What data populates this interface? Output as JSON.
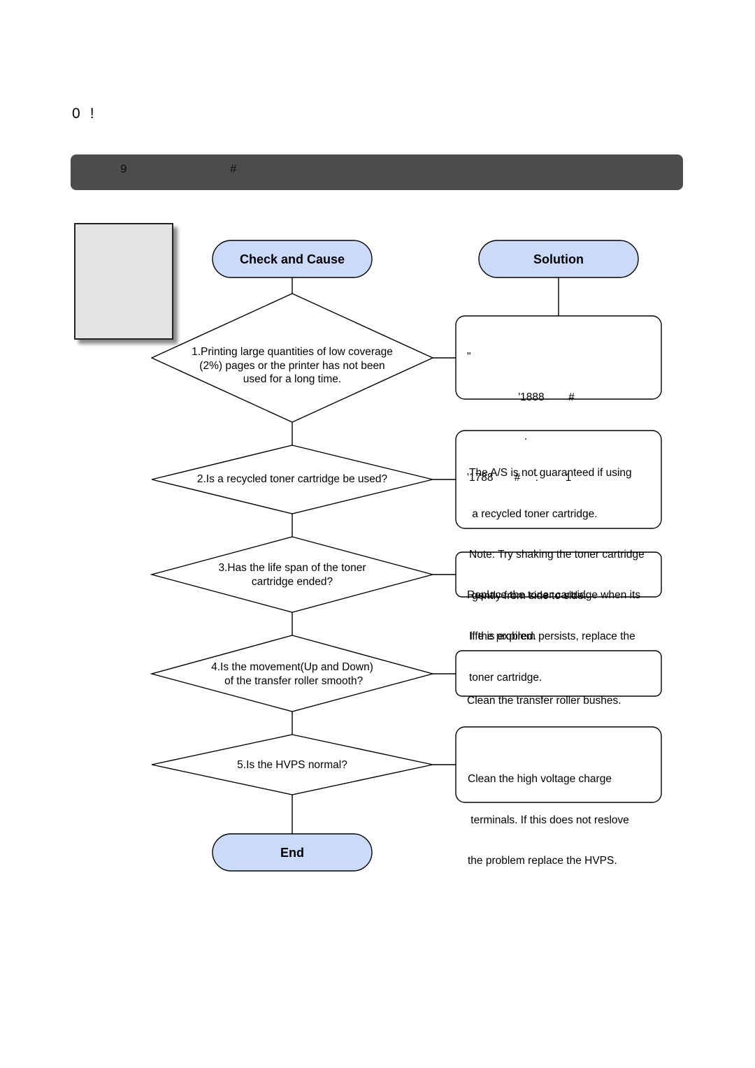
{
  "page": {
    "heading": [
      "0",
      "!"
    ],
    "title_bar": {
      "left": "9",
      "right": "#"
    }
  },
  "flowchart": {
    "headers": {
      "cause": "Check and Cause",
      "solution": "Solution"
    },
    "end_label": "End",
    "steps": [
      {
        "question": [
          "1.Printing large quantities of low coverage",
          "(2%) pages or the printer has not been",
          "used for a long time."
        ],
        "solution": [
          "\"",
          "                 '1888        #",
          "                   .",
          "'1788       #     :         1"
        ]
      },
      {
        "question": [
          "2.Is a recycled toner cartridge be used?"
        ],
        "solution": [
          "The A/S is not guaranteed if using",
          " a recycled toner cartridge.",
          "Note: Try shaking the toner cartridge",
          " gently from side to side.",
          "If the problem persists, replace the",
          "toner cartridge."
        ]
      },
      {
        "question": [
          "3.Has the life span of the toner",
          "cartridge ended?"
        ],
        "solution": [
          "Replace the toner cartridge when its",
          " life is expired."
        ]
      },
      {
        "question": [
          "4.Is the movement(Up and Down)",
          " of the transfer roller smooth?"
        ],
        "solution": [
          "Clean the transfer roller bushes."
        ]
      },
      {
        "question": [
          "5.Is the HVPS normal?"
        ],
        "solution": [
          "Clean the high voltage charge",
          " terminals. If this does not reslove",
          "the problem replace the HVPS."
        ]
      }
    ]
  },
  "colors": {
    "terminal_fill": "#ccdaf9",
    "title_bar": "#4c4c4c",
    "sample_page": "#e3e3e3"
  }
}
